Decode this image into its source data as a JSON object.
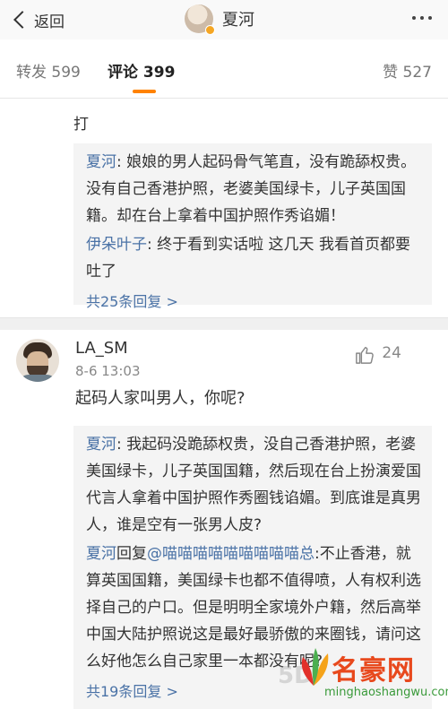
{
  "nav": {
    "back_label": "返回",
    "title": "夏河"
  },
  "stats": {
    "repost": "转发 599",
    "comment": "评论 399",
    "like": "赞 527"
  },
  "cut_text": {
    "line2": "打"
  },
  "thread1": {
    "replies": [
      {
        "who": "夏河",
        "text": "娘娘的男人起码骨气笔直，没有跪舔权贵。没有自己香港护照，老婆美国绿卡，儿子英国国籍。却在台上拿着中国护照作秀谄媚！"
      },
      {
        "who": "伊朵叶子",
        "text": "终于看到实话啦 这几天 我看首页都要吐了"
      }
    ],
    "more": "共25条回复 >"
  },
  "comment2": {
    "user": "LA_SM",
    "time": "8-6 13:03",
    "likes": "24",
    "text": "起码人家叫男人，你呢?"
  },
  "thread2": {
    "replies": [
      {
        "who": "夏河",
        "text": "我起码没跪舔权贵，没自己香港护照，老婆美国绿卡，儿子英国国籍，然后现在台上扮演爱国代言人拿着中国护照作秀圈钱谄媚。到底谁是真男人，谁是空有一张男人皮?"
      },
      {
        "who": "夏河",
        "reply_to": "回复@喵喵喵喵喵喵喵喵喵总",
        "text": ":不止香港，就算英国国籍，美国绿卡也都不值得喷，人有权利选择自己的户口。但是明明全家境外户籍，然后高举中国大陆护照说这是最好最骄傲的来圈钱，请问这么好他怎么自己家里一本都没有呢?"
      }
    ],
    "more": "共19条回复 >"
  },
  "watermark": {
    "brand": "名豪网",
    "url": "minghaoshangwu.com",
    "ghost": "5D"
  },
  "colors": {
    "accent": "#ff8200",
    "link": "#4a72a6",
    "reply_bg": "#f4f4f4"
  }
}
